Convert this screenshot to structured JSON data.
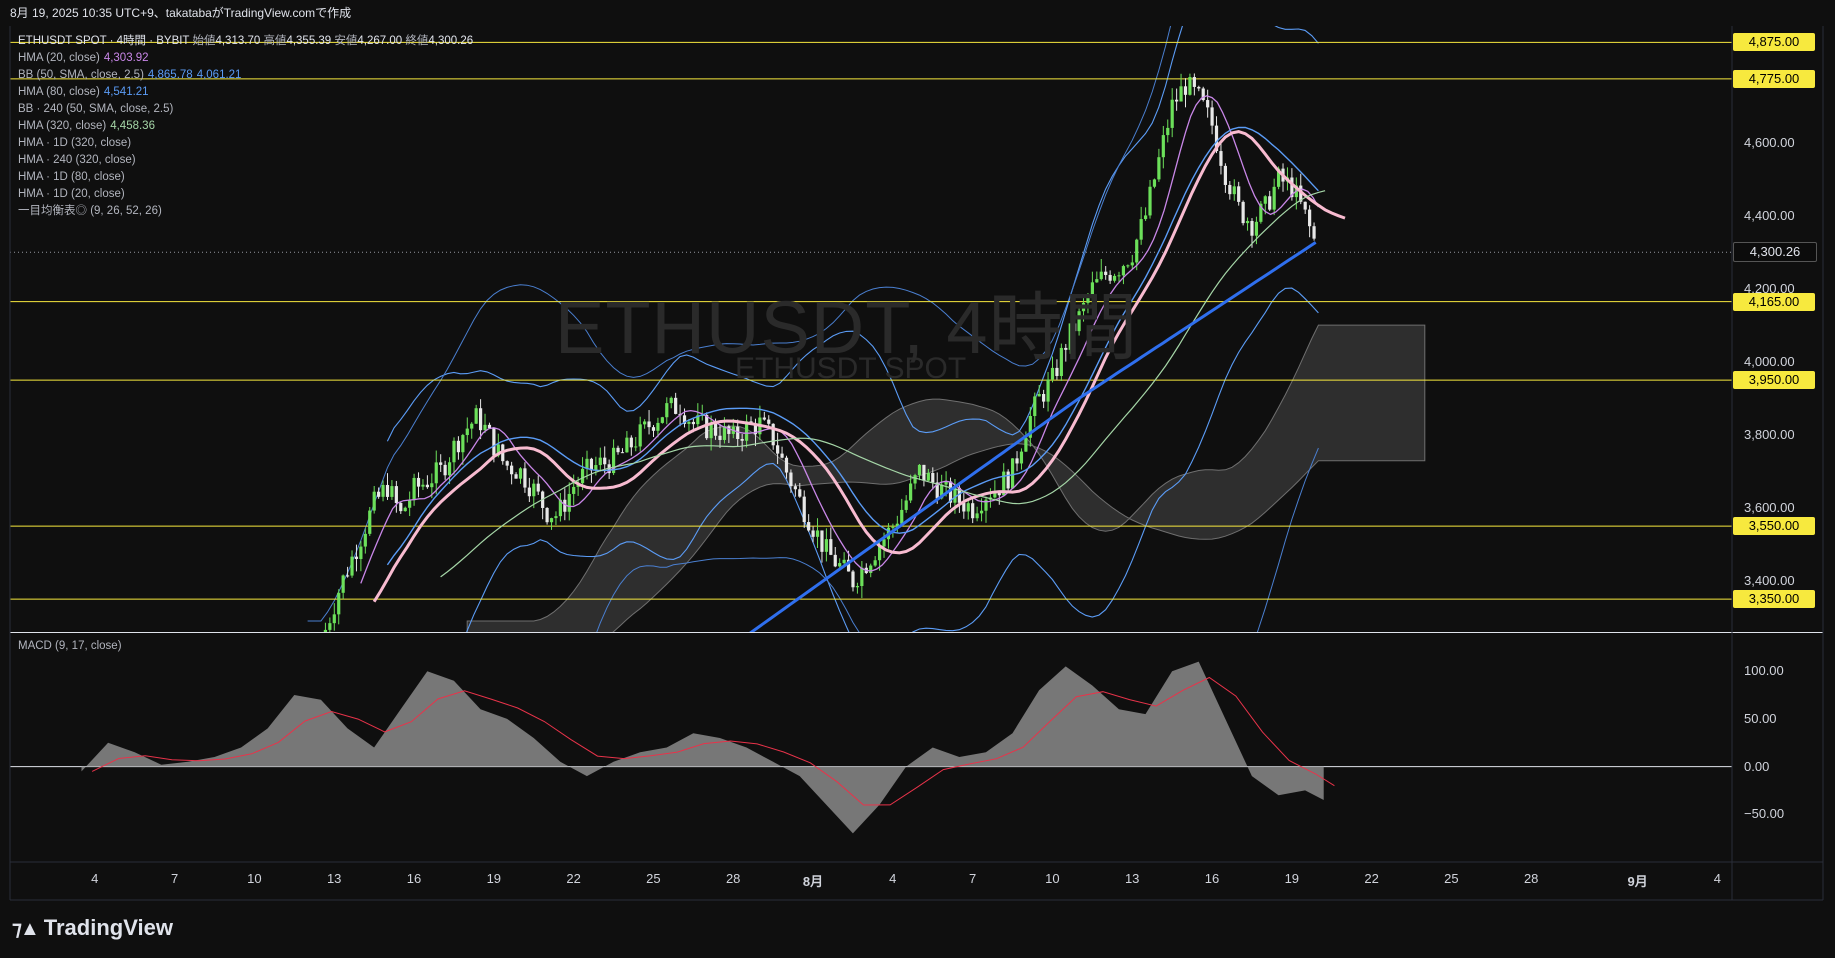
{
  "header": {
    "info": "8月 19, 2025 10:35 UTC+9、takatabaがTradingView.comで作成"
  },
  "watermark": {
    "symbol_big": "ETHUSDT, 4時間",
    "symbol_small": "ETHUSDT SPOT"
  },
  "legend": {
    "main": {
      "title": "ETHUSDT SPOT · 4時間 · BYBIT",
      "open_label": "始値",
      "open": "4,313.70",
      "high_label": "高値",
      "high": "4,355.39",
      "low_label": "安値",
      "low": "4,267.00",
      "close_label": "終値",
      "close": "4,300.26"
    },
    "indicators": [
      {
        "label": "HMA (20, close)",
        "value": "4,303.92",
        "color": "#c987e8"
      },
      {
        "label": "BB (50, SMA, close, 2.5)",
        "value": "4,865.78",
        "value2": "4,061.21",
        "color": "#5b9cf6"
      },
      {
        "label": "HMA (80, close)",
        "value": "4,541.21",
        "color": "#5b9cf6"
      },
      {
        "label": "BB · 240 (50, SMA, close, 2.5)",
        "value": "",
        "color": "#b2b5be"
      },
      {
        "label": "HMA (320, close)",
        "value": "4,458.36",
        "color": "#a5d6a7"
      },
      {
        "label": "HMA · 1D (320, close)",
        "value": "",
        "color": "#b2b5be"
      },
      {
        "label": "HMA · 240 (320, close)",
        "value": "",
        "color": "#b2b5be"
      },
      {
        "label": "HMA · 1D (80, close)",
        "value": "",
        "color": "#b2b5be"
      },
      {
        "label": "HMA · 1D (20, close)",
        "value": "",
        "color": "#b2b5be"
      },
      {
        "label": "一目均衡表◎ (9, 26, 52, 26)",
        "value": "",
        "color": "#b2b5be"
      }
    ]
  },
  "macd": {
    "label": "MACD (9, 17, close)"
  },
  "brand": {
    "name": "TradingView"
  },
  "chart_data": [
    {
      "type": "candlestick",
      "title": "ETHUSDT SPOT · 4時間 · BYBIT",
      "ylim": [
        3260,
        4920
      ],
      "y_ticks": [
        3400,
        3600,
        3800,
        4000,
        4200,
        4400,
        4600
      ],
      "y_tick_labels": [
        "3,400.00",
        "3,600.00",
        "3,800.00",
        "4,000.00",
        "4,200.00",
        "4,400.00",
        "4,600.00"
      ],
      "horizontal_lines": [
        {
          "value": 4875,
          "label": "4,875.00"
        },
        {
          "value": 4775,
          "label": "4,775.00"
        },
        {
          "value": 4165,
          "label": "4,165.00"
        },
        {
          "value": 3950,
          "label": "3,950.00"
        },
        {
          "value": 3550,
          "label": "3,550.00"
        },
        {
          "value": 3350,
          "label": "3,350.00"
        }
      ],
      "last_price": {
        "value": 4300.26,
        "label": "4,300.26"
      },
      "x_labels": [
        "4",
        "7",
        "10",
        "13",
        "16",
        "19",
        "22",
        "25",
        "28",
        "8月",
        "4",
        "7",
        "10",
        "13",
        "16",
        "19",
        "22",
        "25",
        "28",
        "9月",
        "4"
      ],
      "x_label_days": [
        -27,
        -24,
        -21,
        -18,
        -15,
        -12,
        -9,
        -6,
        -3,
        0,
        3,
        6,
        9,
        12,
        15,
        18,
        21,
        24,
        27,
        31,
        34
      ],
      "close_path": [
        [
          -18.5,
          3230
        ],
        [
          -17.8,
          3380
        ],
        [
          -17.0,
          3520
        ],
        [
          -16.5,
          3610
        ],
        [
          -16.0,
          3660
        ],
        [
          -15.5,
          3580
        ],
        [
          -15.0,
          3650
        ],
        [
          -14.0,
          3700
        ],
        [
          -13.4,
          3780
        ],
        [
          -13.0,
          3820
        ],
        [
          -12.6,
          3850
        ],
        [
          -12.2,
          3800
        ],
        [
          -11.6,
          3720
        ],
        [
          -11.0,
          3700
        ],
        [
          -10.5,
          3650
        ],
        [
          -10.0,
          3590
        ],
        [
          -9.6,
          3580
        ],
        [
          -9.0,
          3660
        ],
        [
          -8.5,
          3700
        ],
        [
          -8.0,
          3720
        ],
        [
          -7.5,
          3730
        ],
        [
          -7.0,
          3760
        ],
        [
          -6.5,
          3800
        ],
        [
          -6.0,
          3840
        ],
        [
          -5.5,
          3870
        ],
        [
          -5.0,
          3880
        ],
        [
          -4.5,
          3830
        ],
        [
          -4.0,
          3820
        ],
        [
          -3.5,
          3810
        ],
        [
          -3.0,
          3790
        ],
        [
          -2.5,
          3820
        ],
        [
          -2.0,
          3830
        ],
        [
          -1.5,
          3790
        ],
        [
          -1.0,
          3700
        ],
        [
          -0.5,
          3620
        ],
        [
          0.0,
          3550
        ],
        [
          0.5,
          3480
        ],
        [
          1.0,
          3440
        ],
        [
          1.5,
          3400
        ],
        [
          2.0,
          3450
        ],
        [
          2.5,
          3500
        ],
        [
          3.0,
          3550
        ],
        [
          3.5,
          3620
        ],
        [
          4.0,
          3700
        ],
        [
          4.5,
          3670
        ],
        [
          5.0,
          3640
        ],
        [
          5.5,
          3620
        ],
        [
          6.0,
          3600
        ],
        [
          6.5,
          3640
        ],
        [
          7.0,
          3660
        ],
        [
          7.5,
          3700
        ],
        [
          8.0,
          3820
        ],
        [
          8.5,
          3900
        ],
        [
          9.0,
          3950
        ],
        [
          9.5,
          4050
        ],
        [
          10.0,
          4120
        ],
        [
          10.5,
          4200
        ],
        [
          11.0,
          4240
        ],
        [
          11.5,
          4260
        ],
        [
          12.0,
          4300
        ],
        [
          12.5,
          4400
        ],
        [
          13.0,
          4550
        ],
        [
          13.5,
          4700
        ],
        [
          14.0,
          4760
        ],
        [
          14.5,
          4720
        ],
        [
          15.0,
          4650
        ],
        [
          15.5,
          4520
        ],
        [
          16.0,
          4420
        ],
        [
          16.5,
          4380
        ],
        [
          17.0,
          4420
        ],
        [
          17.5,
          4500
        ],
        [
          18.0,
          4480
        ],
        [
          18.5,
          4400
        ],
        [
          19.0,
          4300
        ]
      ]
    },
    {
      "type": "area",
      "title": "MACD (9, 17, close)",
      "ylim": [
        -100,
        140
      ],
      "y_ticks": [
        -50,
        0,
        50,
        100
      ],
      "y_tick_labels": [
        "−50.00",
        "0.00",
        "50.00",
        "100.00"
      ],
      "series": [
        {
          "name": "MACD",
          "x": [
            -27.5,
            -26.5,
            -25.5,
            -24.5,
            -23.5,
            -22.5,
            -21.5,
            -20.5,
            -19.5,
            -18.5,
            -17.5,
            -16.5,
            -15.5,
            -14.5,
            -13.5,
            -12.5,
            -11.5,
            -10.5,
            -9.5,
            -8.5,
            -7.5,
            -6.5,
            -5.5,
            -4.5,
            -3.5,
            -2.5,
            -1.5,
            -0.5,
            0.5,
            1.5,
            2.5,
            3.5,
            4.5,
            5.5,
            6.5,
            7.5,
            8.5,
            9.5,
            10.5,
            11.5,
            12.5,
            13.5,
            14.5,
            15.5,
            16.5,
            17.5,
            18.5,
            19.2
          ],
          "values": [
            -5,
            25,
            15,
            2,
            5,
            10,
            20,
            40,
            75,
            70,
            40,
            20,
            60,
            100,
            90,
            60,
            50,
            30,
            5,
            -10,
            5,
            15,
            20,
            35,
            30,
            20,
            5,
            -10,
            -40,
            -70,
            -40,
            0,
            20,
            10,
            15,
            35,
            80,
            105,
            85,
            60,
            55,
            100,
            110,
            50,
            -10,
            -30,
            -25,
            -35
          ]
        }
      ]
    }
  ]
}
